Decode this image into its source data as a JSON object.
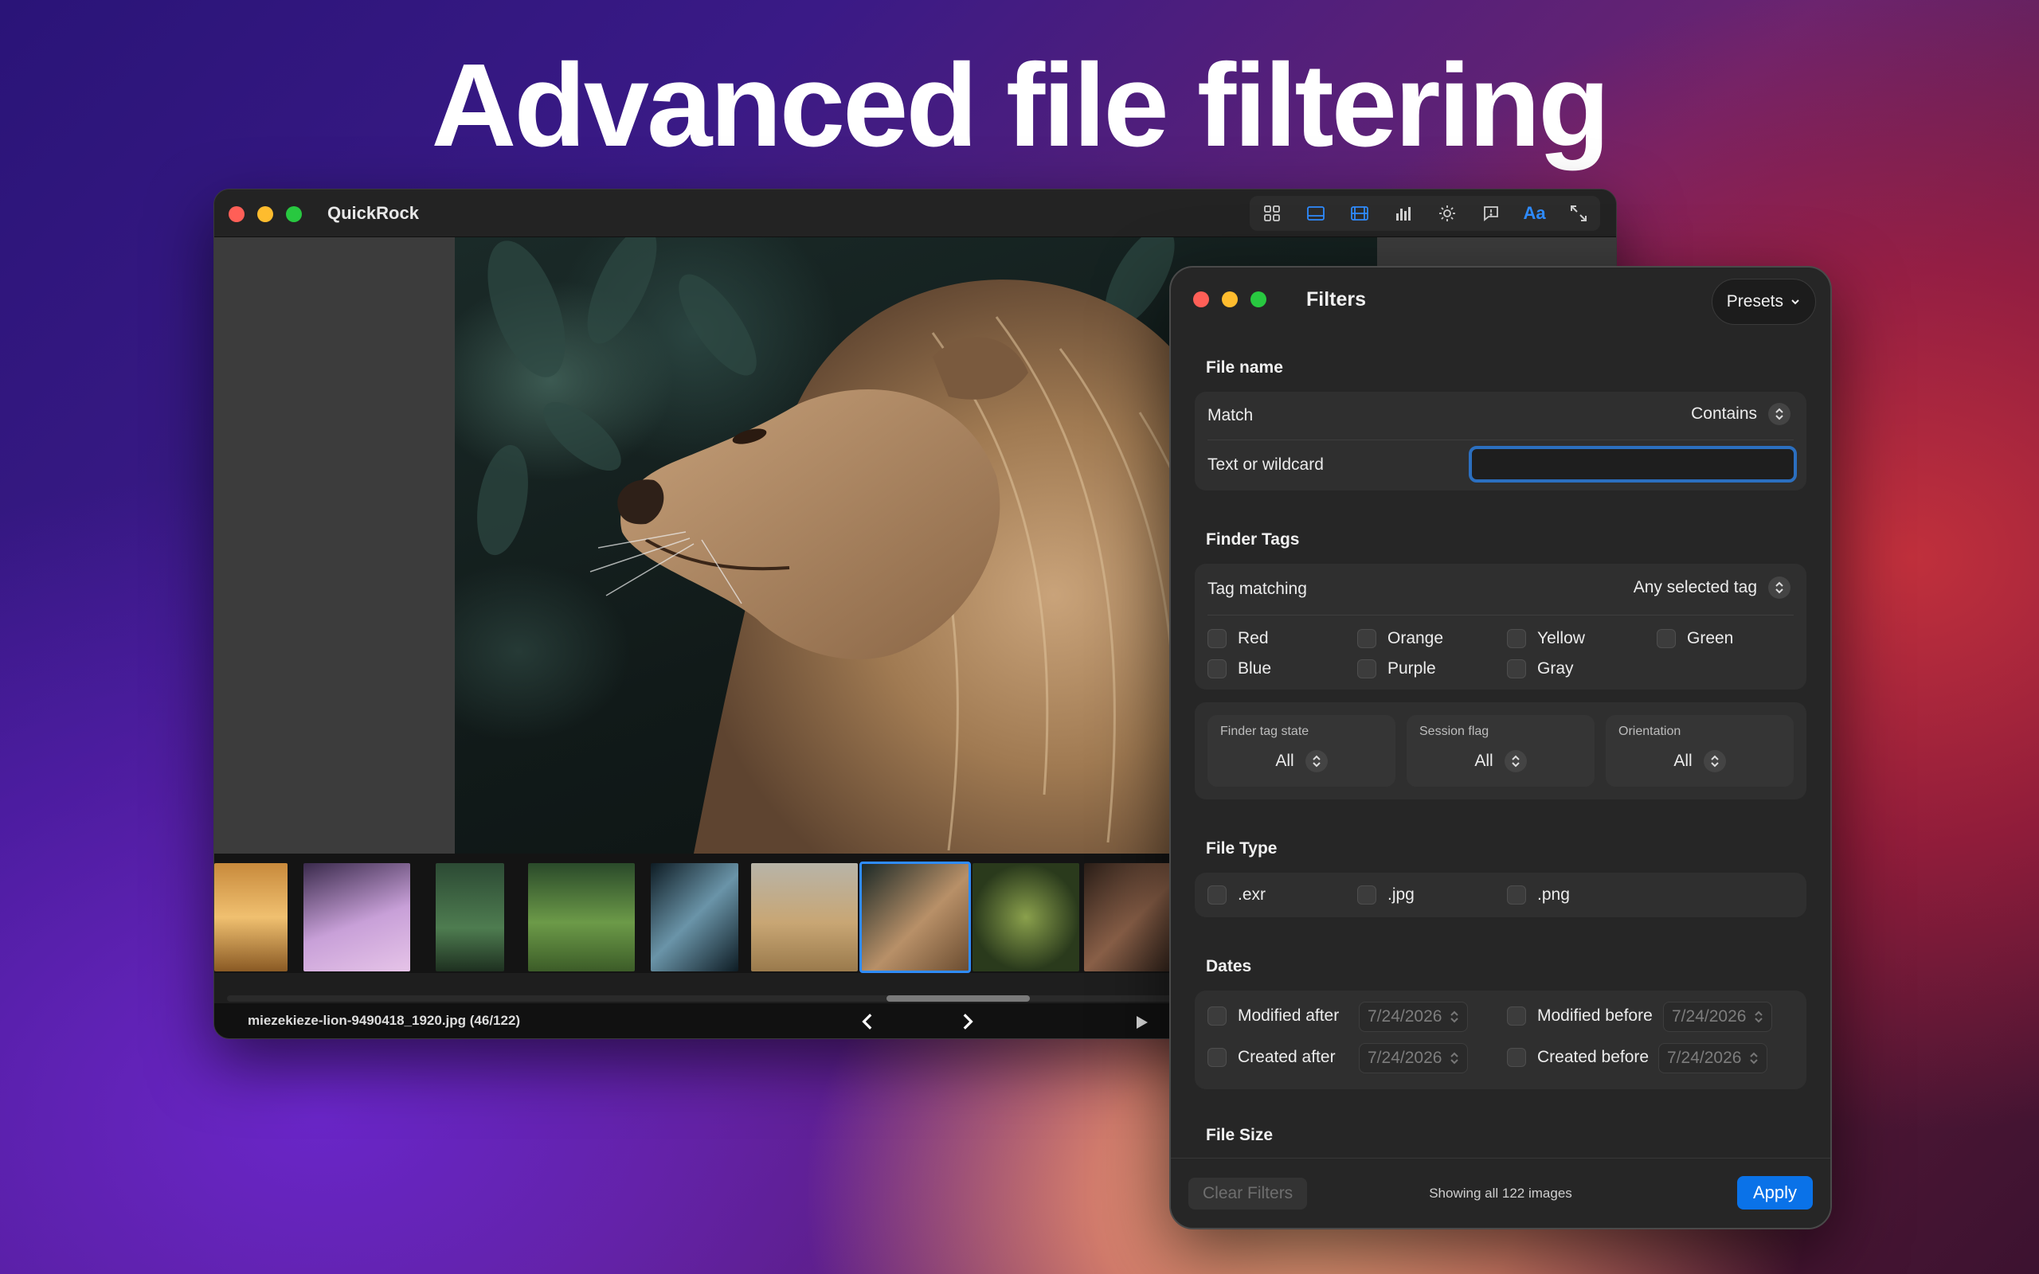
{
  "headline": "Advanced file filtering",
  "viewer": {
    "title": "QuickRock",
    "toolbar_icons": [
      "grid-icon",
      "single-view-icon",
      "filmstrip-icon",
      "histogram-icon",
      "brightness-icon",
      "comment-icon",
      "text-icon",
      "fullscreen-icon"
    ],
    "toolbar_text_label": "Aa",
    "accent": "#2f8cff",
    "status_text": "miezekieze-lion-9490418_1920.jpg (46/122)"
  },
  "filters": {
    "title": "Filters",
    "presets_label": "Presets",
    "file_name": {
      "section_title": "File name",
      "match_label": "Match",
      "match_value": "Contains",
      "text_label": "Text or wildcard",
      "text_value": ""
    },
    "finder_tags": {
      "section_title": "Finder Tags",
      "matching_label": "Tag matching",
      "matching_value": "Any selected tag",
      "tags": [
        "Red",
        "Orange",
        "Yellow",
        "Green",
        "Blue",
        "Purple",
        "Gray"
      ]
    },
    "states": [
      {
        "label": "Finder tag state",
        "value": "All"
      },
      {
        "label": "Session flag",
        "value": "All"
      },
      {
        "label": "Orientation",
        "value": "All"
      }
    ],
    "file_type": {
      "section_title": "File Type",
      "types": [
        ".exr",
        ".jpg",
        ".png"
      ]
    },
    "dates": {
      "section_title": "Dates",
      "modified_after_label": "Modified after",
      "modified_after_value": "7/24/2026",
      "modified_before_label": "Modified before",
      "modified_before_value": "7/24/2026",
      "created_after_label": "Created after",
      "created_after_value": "7/24/2026",
      "created_before_label": "Created before",
      "created_before_value": "7/24/2026"
    },
    "file_size": {
      "section_title": "File Size"
    },
    "clear_label": "Clear Filters",
    "showing_text": "Showing all 122 images",
    "apply_label": "Apply",
    "apply_color": "#0a72e8"
  }
}
